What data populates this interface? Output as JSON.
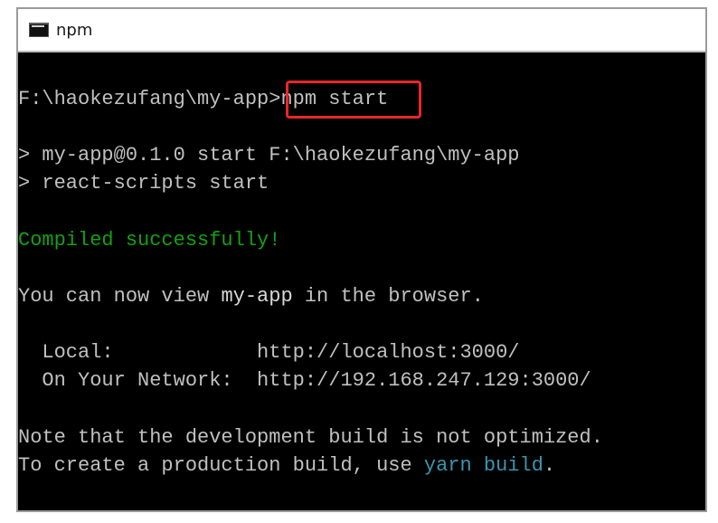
{
  "window": {
    "title": "npm"
  },
  "console": {
    "prompt_path": "F:\\haokezufang\\my-app>",
    "command": "npm start",
    "script_line_1": "> my-app@0.1.0 start F:\\haokezufang\\my-app",
    "script_line_2": "> react-scripts start",
    "compiled": "Compiled successfully!",
    "view_prefix": "You can now view ",
    "view_app": "my-app",
    "view_suffix": " in the browser.",
    "local_label": "  Local:            ",
    "local_url": "http://localhost:3000/",
    "network_label": "  On Your Network:  ",
    "network_url": "http://192.168.247.129:3000/",
    "note_line": "Note that the development build is not optimized.",
    "build_prefix": "To create a production build, use ",
    "build_cmd": "yarn build",
    "build_suffix": "."
  },
  "colors": {
    "success": "#13a10e",
    "link": "#3a96b0",
    "highlight": "#e8262b"
  }
}
